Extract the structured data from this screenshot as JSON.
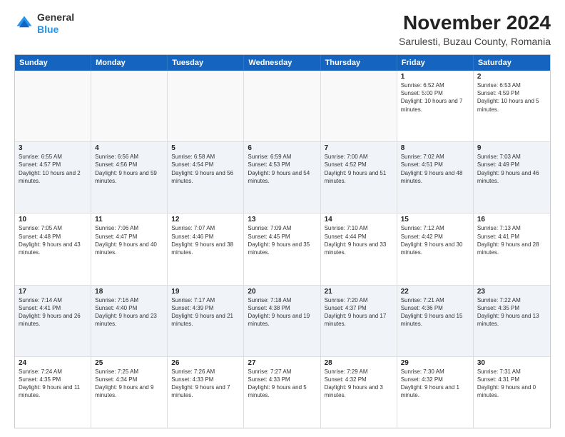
{
  "header": {
    "logo_line1": "General",
    "logo_line2": "Blue",
    "month_title": "November 2024",
    "location": "Sarulesti, Buzau County, Romania"
  },
  "days_of_week": [
    "Sunday",
    "Monday",
    "Tuesday",
    "Wednesday",
    "Thursday",
    "Friday",
    "Saturday"
  ],
  "weeks": [
    {
      "alt": false,
      "cells": [
        {
          "day": "",
          "info": ""
        },
        {
          "day": "",
          "info": ""
        },
        {
          "day": "",
          "info": ""
        },
        {
          "day": "",
          "info": ""
        },
        {
          "day": "",
          "info": ""
        },
        {
          "day": "1",
          "info": "Sunrise: 6:52 AM\nSunset: 5:00 PM\nDaylight: 10 hours and 7 minutes."
        },
        {
          "day": "2",
          "info": "Sunrise: 6:53 AM\nSunset: 4:59 PM\nDaylight: 10 hours and 5 minutes."
        }
      ]
    },
    {
      "alt": true,
      "cells": [
        {
          "day": "3",
          "info": "Sunrise: 6:55 AM\nSunset: 4:57 PM\nDaylight: 10 hours and 2 minutes."
        },
        {
          "day": "4",
          "info": "Sunrise: 6:56 AM\nSunset: 4:56 PM\nDaylight: 9 hours and 59 minutes."
        },
        {
          "day": "5",
          "info": "Sunrise: 6:58 AM\nSunset: 4:54 PM\nDaylight: 9 hours and 56 minutes."
        },
        {
          "day": "6",
          "info": "Sunrise: 6:59 AM\nSunset: 4:53 PM\nDaylight: 9 hours and 54 minutes."
        },
        {
          "day": "7",
          "info": "Sunrise: 7:00 AM\nSunset: 4:52 PM\nDaylight: 9 hours and 51 minutes."
        },
        {
          "day": "8",
          "info": "Sunrise: 7:02 AM\nSunset: 4:51 PM\nDaylight: 9 hours and 48 minutes."
        },
        {
          "day": "9",
          "info": "Sunrise: 7:03 AM\nSunset: 4:49 PM\nDaylight: 9 hours and 46 minutes."
        }
      ]
    },
    {
      "alt": false,
      "cells": [
        {
          "day": "10",
          "info": "Sunrise: 7:05 AM\nSunset: 4:48 PM\nDaylight: 9 hours and 43 minutes."
        },
        {
          "day": "11",
          "info": "Sunrise: 7:06 AM\nSunset: 4:47 PM\nDaylight: 9 hours and 40 minutes."
        },
        {
          "day": "12",
          "info": "Sunrise: 7:07 AM\nSunset: 4:46 PM\nDaylight: 9 hours and 38 minutes."
        },
        {
          "day": "13",
          "info": "Sunrise: 7:09 AM\nSunset: 4:45 PM\nDaylight: 9 hours and 35 minutes."
        },
        {
          "day": "14",
          "info": "Sunrise: 7:10 AM\nSunset: 4:44 PM\nDaylight: 9 hours and 33 minutes."
        },
        {
          "day": "15",
          "info": "Sunrise: 7:12 AM\nSunset: 4:42 PM\nDaylight: 9 hours and 30 minutes."
        },
        {
          "day": "16",
          "info": "Sunrise: 7:13 AM\nSunset: 4:41 PM\nDaylight: 9 hours and 28 minutes."
        }
      ]
    },
    {
      "alt": true,
      "cells": [
        {
          "day": "17",
          "info": "Sunrise: 7:14 AM\nSunset: 4:41 PM\nDaylight: 9 hours and 26 minutes."
        },
        {
          "day": "18",
          "info": "Sunrise: 7:16 AM\nSunset: 4:40 PM\nDaylight: 9 hours and 23 minutes."
        },
        {
          "day": "19",
          "info": "Sunrise: 7:17 AM\nSunset: 4:39 PM\nDaylight: 9 hours and 21 minutes."
        },
        {
          "day": "20",
          "info": "Sunrise: 7:18 AM\nSunset: 4:38 PM\nDaylight: 9 hours and 19 minutes."
        },
        {
          "day": "21",
          "info": "Sunrise: 7:20 AM\nSunset: 4:37 PM\nDaylight: 9 hours and 17 minutes."
        },
        {
          "day": "22",
          "info": "Sunrise: 7:21 AM\nSunset: 4:36 PM\nDaylight: 9 hours and 15 minutes."
        },
        {
          "day": "23",
          "info": "Sunrise: 7:22 AM\nSunset: 4:35 PM\nDaylight: 9 hours and 13 minutes."
        }
      ]
    },
    {
      "alt": false,
      "cells": [
        {
          "day": "24",
          "info": "Sunrise: 7:24 AM\nSunset: 4:35 PM\nDaylight: 9 hours and 11 minutes."
        },
        {
          "day": "25",
          "info": "Sunrise: 7:25 AM\nSunset: 4:34 PM\nDaylight: 9 hours and 9 minutes."
        },
        {
          "day": "26",
          "info": "Sunrise: 7:26 AM\nSunset: 4:33 PM\nDaylight: 9 hours and 7 minutes."
        },
        {
          "day": "27",
          "info": "Sunrise: 7:27 AM\nSunset: 4:33 PM\nDaylight: 9 hours and 5 minutes."
        },
        {
          "day": "28",
          "info": "Sunrise: 7:29 AM\nSunset: 4:32 PM\nDaylight: 9 hours and 3 minutes."
        },
        {
          "day": "29",
          "info": "Sunrise: 7:30 AM\nSunset: 4:32 PM\nDaylight: 9 hours and 1 minute."
        },
        {
          "day": "30",
          "info": "Sunrise: 7:31 AM\nSunset: 4:31 PM\nDaylight: 9 hours and 0 minutes."
        }
      ]
    }
  ]
}
